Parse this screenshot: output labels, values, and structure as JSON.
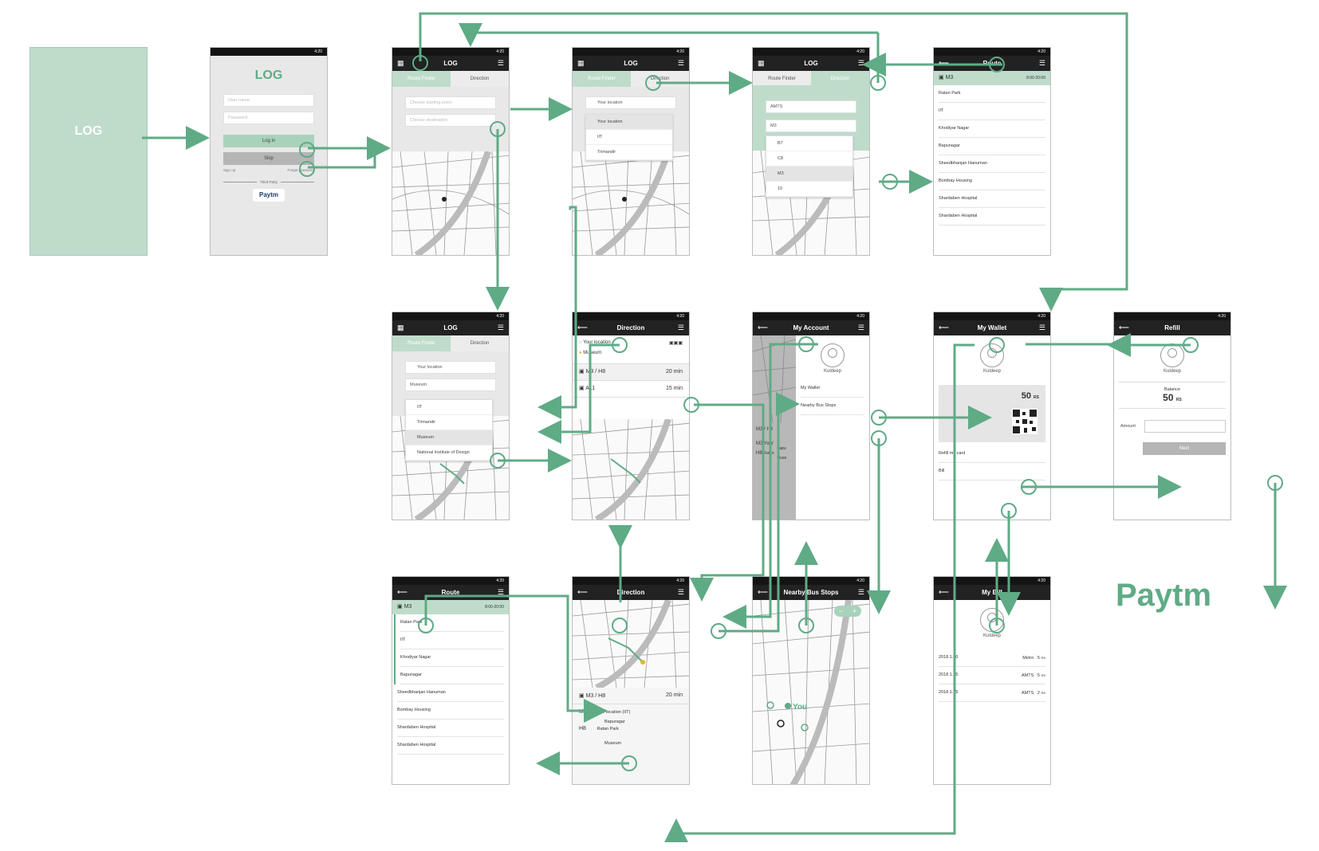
{
  "splash": {
    "title": "LOG"
  },
  "status_time": "4:20",
  "login": {
    "title": "LOG",
    "username_placeholder": "User name",
    "password_placeholder": "Password",
    "login_label": "Log in",
    "skip_label": "Skip",
    "signup_label": "Sign up",
    "forgot_label": "Forget password",
    "third_party_label": "Third Party",
    "paytm_label": "Paytm"
  },
  "routefinder": {
    "app_title": "LOG",
    "tab_route": "Route Finder",
    "tab_direction": "Direction",
    "start_placeholder": "Choose starting point",
    "dest_placeholder": "Choose destination"
  },
  "choose_start": {
    "field": "Your location",
    "options": [
      "Your location",
      "IIT",
      "Trimandir"
    ]
  },
  "bus_search": {
    "field1": "AMTS",
    "field2": "M3",
    "options": [
      "B7",
      "C8",
      "M3",
      "10"
    ]
  },
  "route": {
    "title": "Route",
    "bus": "M3",
    "hours": "8:00-20:00",
    "stops": [
      "Ratan Park",
      "IIT",
      "Khodiyar Nagar",
      "Bapunagar",
      "Sheedbhanjan Hanuman",
      "Bombay Housing",
      "Shardaben Hospital",
      "Shardaben Hospital"
    ]
  },
  "choose_dest": {
    "field1": "Your location",
    "field2": "Museum",
    "options": [
      "IIT",
      "Trimandir",
      "Museum",
      "National Institute of Design"
    ]
  },
  "direction": {
    "title": "Direction",
    "from": "Your location",
    "to": "Museum",
    "option1_bus": "M3 / H8",
    "option1_time": "20 min",
    "option2_bus": "A11",
    "option2_time": "15 min"
  },
  "account": {
    "title": "My Account",
    "name": "Kuldeep",
    "menu": [
      "My Wallet",
      "Nearby Bus Stops"
    ],
    "route_summary": "M3 / H8",
    "leg1_bus": "M3",
    "leg1_stops": [
      "Your",
      "Bapu",
      "Ratan"
    ],
    "leg2_bus": "H8",
    "leg2_stops": [
      "Muse"
    ]
  },
  "wallet": {
    "title": "My Wallet",
    "name": "Kuldeep",
    "balance": "50",
    "currency": "RS",
    "refill_label": "Refill my card",
    "bill_label": "Bill"
  },
  "refill": {
    "title": "Refill",
    "name": "Kuldeep",
    "balance_label": "Balance",
    "balance": "50",
    "currency": "RS",
    "amount_label": "Amount",
    "next_label": "Next"
  },
  "direction_detail": {
    "title": "Direction",
    "bus": "M3 / H8",
    "time": "20 min",
    "leg1_bus": "M3",
    "leg1_stops": [
      "Your location (IIT)",
      "Bapuragar",
      "Ratan Park"
    ],
    "leg2_bus": "H8",
    "leg2_stops": [
      "Museum"
    ]
  },
  "nearby": {
    "title": "Nearby Bus Stops",
    "you_label": "You",
    "zoom_out": "−",
    "zoom_in": "+"
  },
  "bill": {
    "title": "My Bill",
    "name": "Kuldeep",
    "rows": [
      {
        "date": "2018.1.10",
        "type": "Metro",
        "amount": "5",
        "currency": "RS"
      },
      {
        "date": "2018.1.05",
        "type": "AMTS",
        "amount": "5",
        "currency": "RS"
      },
      {
        "date": "2018.1.05",
        "type": "AMTS",
        "amount": "2",
        "currency": "RS"
      }
    ]
  },
  "paytm_brand": "Paytm",
  "colors": {
    "accent": "#5fab86",
    "light_green": "#bfdccb",
    "dark_bar": "#222222"
  }
}
